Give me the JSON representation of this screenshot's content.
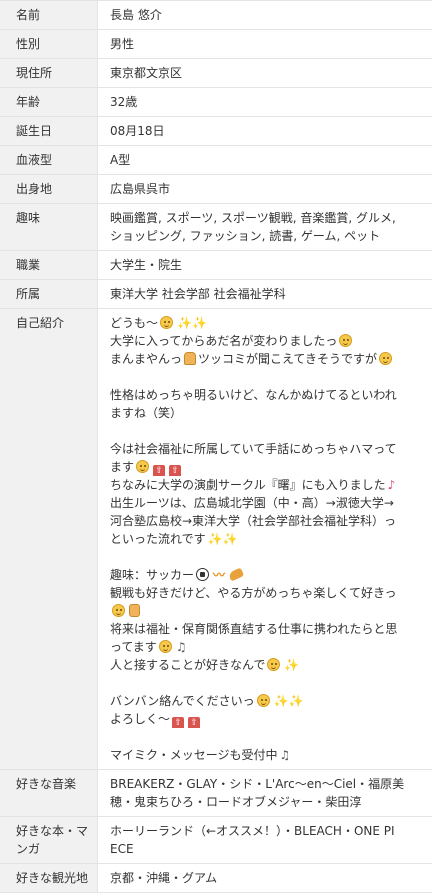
{
  "profile": {
    "name": {
      "label": "名前",
      "value": "長島 悠介"
    },
    "gender": {
      "label": "性別",
      "value": "男性"
    },
    "residence": {
      "label": "現住所",
      "value": "東京都文京区"
    },
    "age": {
      "label": "年齢",
      "value": "32歳"
    },
    "birthday": {
      "label": "誕生日",
      "value": "08月18日"
    },
    "blood_type": {
      "label": "血液型",
      "value": "A型"
    },
    "hometown": {
      "label": "出身地",
      "value": "広島県呉市"
    },
    "hobbies": {
      "label": "趣味",
      "lines": [
        "映画鑑賞, スポーツ, スポーツ観戦, 音楽鑑賞, グルメ,",
        "ショッピング, ファッション, 読書, ゲーム, ペット"
      ]
    },
    "occupation": {
      "label": "職業",
      "value": "大学生・院生"
    },
    "affiliation": {
      "label": "所属",
      "value": "東洋大学 社会学部 社会福祉学科"
    },
    "intro": {
      "label": "自己紹介",
      "lines": [
        "どうも～",
        "大学に入ってからあだ名が変わりましたっ",
        "まんまやんっ",
        "ツッコミが聞こえてきそうですが",
        "",
        "性格はめっちゃ明るいけど、なんかぬけてるといわれ",
        "ますね（笑）",
        "",
        "今は社会福祉に所属していて手話にめっちゃハマって",
        "ます",
        "ちなみに大学の演劇サークル『曙』にも入りました",
        "出生ルーツは、広島城北学園（中・高）→淑徳大学→",
        "河合塾広島校→東洋大学（社会学部社会福祉学科）っ",
        "といった流れです",
        "",
        "趣味：サッカー",
        "観戦も好きだけど、やる方がめっちゃ楽しくて好きっ",
        "",
        "将来は福祉・保育関係直結する仕事に携われたらと思",
        "ってます",
        "人と接することが好きなんで",
        "",
        "バンバン絡んでくださいっ",
        "よろしく～",
        "",
        "マイミク・メッセージも受付中"
      ]
    },
    "music": {
      "label": "好きな音楽",
      "lines": [
        "BREAKERZ・GLAY・シド・L'Arc～en～Ciel・福原美",
        "穂・鬼束ちひろ・ロードオブメジャー・柴田淳"
      ]
    },
    "books": {
      "label_lines": [
        "好きな本・マ",
        "ンガ"
      ],
      "lines": [
        "ホーリーランド（←オススメ！）・BLEACH・ONE PI",
        "ECE"
      ]
    },
    "sightseeing": {
      "label": "好きな観光地",
      "value": "京都・沖縄・グアム"
    }
  },
  "icons": {
    "smile": "smile-face-icon",
    "sparkle": "sparkle-icon",
    "arrow": "up-arrow-icon",
    "hand": "raised-hand-icon",
    "note": "music-note-icon",
    "ball": "soccer-ball-icon",
    "wave": "wave-icon",
    "shoe": "sneaker-icon",
    "thumb": "thumbs-up-icon"
  },
  "colors": {
    "label_background": "#f1f1f1",
    "border": "#e4e4e4",
    "text": "#333333"
  }
}
